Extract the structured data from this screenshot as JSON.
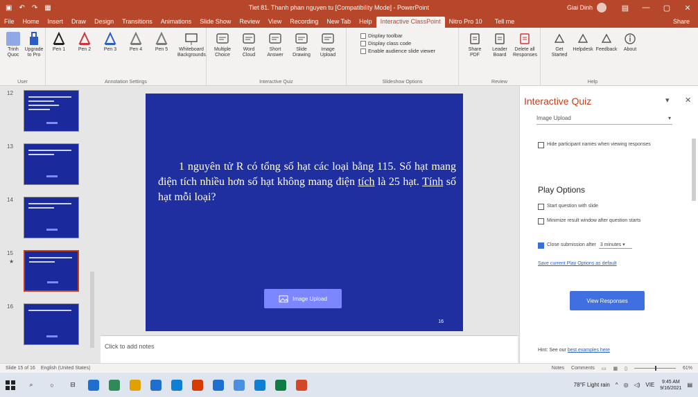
{
  "window": {
    "title": "Tiet 81. Thanh phan nguyen tu [Compatibility Mode] - PowerPoint",
    "user": "Giai Dinh",
    "qa_icons": [
      "save-icon",
      "undo-icon",
      "redo-icon",
      "present-icon"
    ]
  },
  "tabs": [
    "File",
    "Home",
    "Insert",
    "Draw",
    "Design",
    "Transitions",
    "Animations",
    "Slide Show",
    "Review",
    "View",
    "Recording",
    "New Tab",
    "Help",
    "Interactive ClassPoint",
    "Nitro Pro 10"
  ],
  "active_tab": "Interactive ClassPoint",
  "tell_me": "Tell me",
  "share": "Share",
  "ribbon": {
    "user_group": {
      "label": "User",
      "buttons": [
        {
          "label": "Trinh\nQuoc",
          "icon": "user-icon"
        },
        {
          "label": "Upgrade\nto Pro",
          "icon": "upgrade-icon"
        }
      ]
    },
    "annotation_group": {
      "label": "Annotation Settings",
      "pens": [
        "Pen 1",
        "Pen 2",
        "Pen 3",
        "Pen 4",
        "Pen 5"
      ],
      "pen_colors": [
        "#222222",
        "#d13438",
        "#2b5cc7",
        "#7a7a7a",
        "#7a7a7a"
      ],
      "whiteboard": "Whiteboard\nBackgrounds"
    },
    "interactive_group": {
      "label": "Interactive Quiz",
      "buttons": [
        "Multiple\nChoice",
        "Word\nCloud",
        "Short\nAnswer",
        "Slide\nDrawing",
        "Image\nUpload"
      ]
    },
    "slideshow_group": {
      "label": "Slideshow Options",
      "checks": [
        "Display toolbar",
        "Display class code",
        "Enable audience slide viewer"
      ]
    },
    "review_group": {
      "label": "Review",
      "buttons": [
        "Share\nPDF",
        "Leader\nBoard",
        "Delete all\nResponses"
      ]
    },
    "help_group": {
      "label": "Help",
      "buttons": [
        "Get\nStarted",
        "Helpdesk",
        "Feedback",
        "About"
      ]
    }
  },
  "thumbnails": [
    {
      "num": "12",
      "lines": 4,
      "selected": false,
      "star": ""
    },
    {
      "num": "13",
      "lines": 2,
      "selected": false,
      "star": ""
    },
    {
      "num": "14",
      "lines": 2,
      "selected": false,
      "star": ""
    },
    {
      "num": "15",
      "lines": 2,
      "selected": true,
      "star": "★"
    },
    {
      "num": "16",
      "lines": 1,
      "selected": false,
      "star": ""
    }
  ],
  "slide": {
    "text_main": "1 nguyên tử R có tổng số hạt các loại bằng 115. Số hạt mang điện tích nhiều hơn số hạt không mang điện ",
    "text_u1": "tích",
    "text_mid": " là 25 hạt. ",
    "text_u2": "Tính",
    "text_end": " số hạt mỗi loại?",
    "upload_label": "Image Upload",
    "page_number": "16"
  },
  "notes_placeholder": "Click to add notes",
  "pane": {
    "title": "Interactive Quiz",
    "dropdown_value": "Image Upload",
    "hide_names": "Hide participant names when viewing responses",
    "play_options": "Play Options",
    "start_with_slide": "Start question with slide",
    "minimize": "Minimize result window after question starts",
    "close_after": "Close submission after",
    "close_value": "3 minutes",
    "save_link": "Save current Play Options as default",
    "view_responses": "View Responses",
    "footer_prefix": "Hint: See our",
    "footer_link": "best examples here"
  },
  "status": {
    "slide_info": "Slide 15 of 16",
    "language": "English (United States)",
    "notes": "Notes",
    "comments": "Comments",
    "zoom": "61%"
  },
  "taskbar": {
    "weather": "78°F Light rain",
    "lang": "VIE",
    "time": "9:45 AM",
    "date": "9/16/2021",
    "app_colors": [
      "#1f6fd1",
      "#2e8b57",
      "#e0a000",
      "#1f6fd1",
      "#0f7fd6",
      "#d83b01",
      "#1f6fd1",
      "#4a90e2",
      "#0f7fd6",
      "#107c41",
      "#d24726"
    ]
  }
}
